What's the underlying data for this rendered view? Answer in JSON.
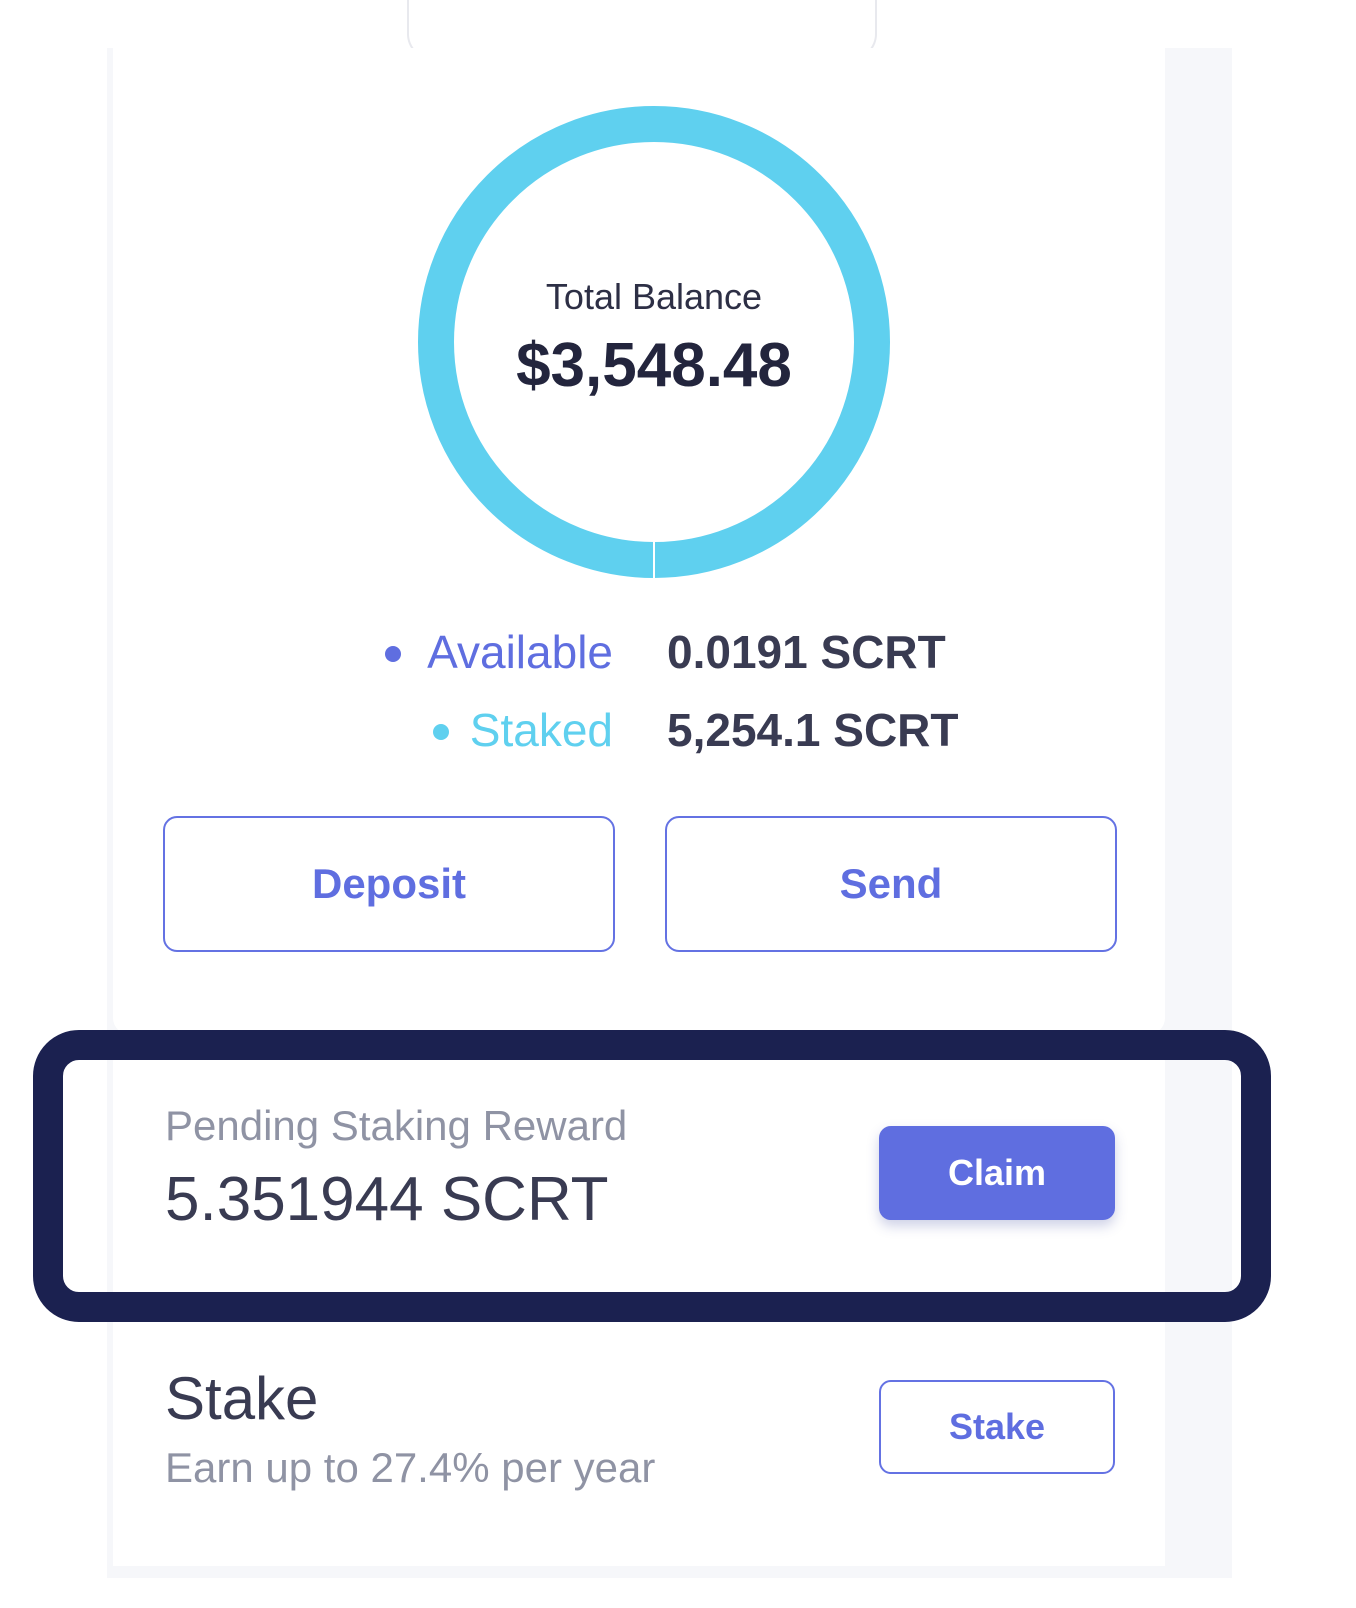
{
  "balance": {
    "label": "Total Balance",
    "value": "$3,548.48",
    "available_label": "Available",
    "available_value": "0.0191 SCRT",
    "staked_label": "Staked",
    "staked_value": "5,254.1 SCRT",
    "available_color": "#5f6ee0",
    "staked_color": "#5fd0ef"
  },
  "actions": {
    "deposit_label": "Deposit",
    "send_label": "Send"
  },
  "reward": {
    "label": "Pending Staking Reward",
    "value": "5.351944 SCRT",
    "claim_label": "Claim"
  },
  "stake": {
    "title": "Stake",
    "subtitle": "Earn up to 27.4% per year",
    "button_label": "Stake"
  }
}
